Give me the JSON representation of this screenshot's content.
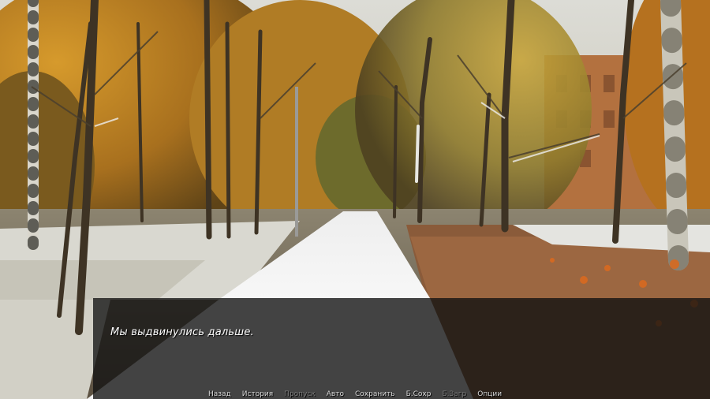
{
  "dialogue": {
    "text": "Мы выдвинулись дальше."
  },
  "quick_menu": {
    "items": [
      {
        "label": "Назад",
        "enabled": true
      },
      {
        "label": "История",
        "enabled": true
      },
      {
        "label": "Пропуск",
        "enabled": false
      },
      {
        "label": "Авто",
        "enabled": true
      },
      {
        "label": "Сохранить",
        "enabled": true
      },
      {
        "label": "Б.Сохр",
        "enabled": true
      },
      {
        "label": "Б.Загр",
        "enabled": false
      },
      {
        "label": "Опции",
        "enabled": true
      }
    ]
  },
  "colors": {
    "text": "#ffffff",
    "menu_enabled": "#d8d8d8",
    "menu_disabled": "#7a7a7a",
    "textbox_bg": "#121212"
  }
}
